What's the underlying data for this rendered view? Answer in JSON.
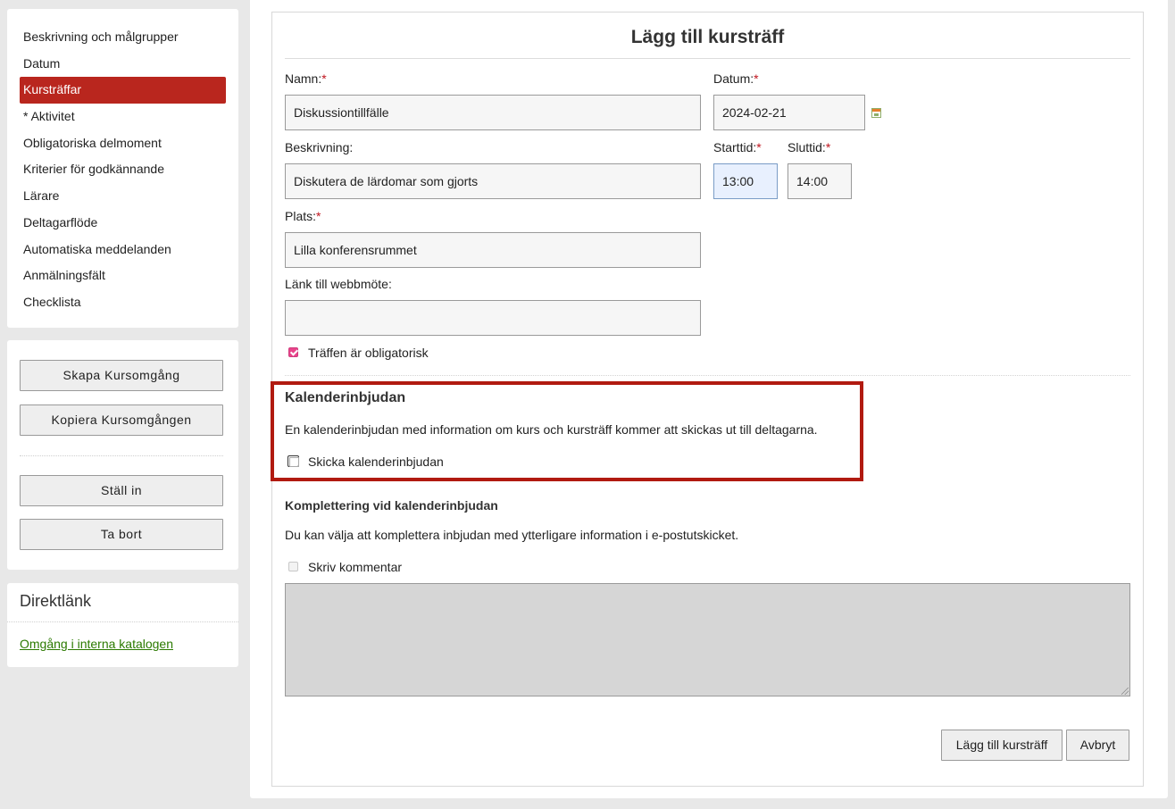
{
  "sidebar": {
    "items": [
      {
        "label": "Beskrivning och målgrupper"
      },
      {
        "label": "Datum"
      },
      {
        "label": "Kursträffar",
        "active": true
      },
      {
        "label": "* Aktivitet"
      },
      {
        "label": "Obligatoriska delmoment"
      },
      {
        "label": "Kriterier för godkännande"
      },
      {
        "label": "Lärare"
      },
      {
        "label": "Deltagarflöde"
      },
      {
        "label": "Automatiska meddelanden"
      },
      {
        "label": "Anmälningsfält"
      },
      {
        "label": "Checklista"
      }
    ],
    "actions": {
      "create": "Skapa Kursomgång",
      "copy": "Kopiera Kursomgången",
      "cancel": "Ställ in",
      "delete": "Ta bort"
    },
    "direct": {
      "title": "Direktlänk",
      "link": "Omgång i interna katalogen"
    }
  },
  "form": {
    "title": "Lägg till kursträff",
    "required_marker": "*",
    "name": {
      "label": "Namn:",
      "value": "Diskussiontillfälle"
    },
    "date": {
      "label": "Datum:",
      "value": "2024-02-21",
      "icon": "calendar-icon"
    },
    "description": {
      "label": "Beskrivning:",
      "value": "Diskutera de lärdomar som gjorts"
    },
    "start": {
      "label": "Starttid:",
      "value": "13:00"
    },
    "end": {
      "label": "Sluttid:",
      "value": "14:00"
    },
    "place": {
      "label": "Plats:",
      "value": "Lilla konferensrummet"
    },
    "webmeeting": {
      "label": "Länk till webbmöte:",
      "value": ""
    },
    "mandatory": {
      "label": "Träffen är obligatorisk",
      "checked": true
    },
    "calendar": {
      "title": "Kalenderinbjudan",
      "text": "En kalenderinbjudan med information om kurs och kursträff kommer att skickas ut till deltagarna.",
      "send_label": "Skicka kalenderinbjudan",
      "send_checked": false
    },
    "supplement": {
      "title": "Komplettering vid kalenderinbjudan",
      "text": "Du kan välja att komplettera inbjudan med ytterligare information i e-postutskicket.",
      "comment_label": "Skriv kommentar",
      "comment_value": ""
    },
    "buttons": {
      "submit": "Lägg till kursträff",
      "cancel": "Avbryt"
    }
  },
  "colors": {
    "accent": "#b9261e",
    "highlight_border": "#b11a10",
    "link": "#2b7a00",
    "required": "#c0141e"
  }
}
